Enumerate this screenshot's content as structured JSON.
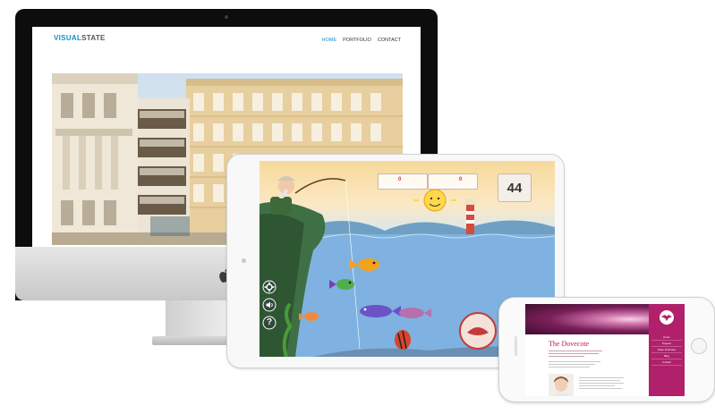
{
  "desktop": {
    "site": {
      "logo_bold": "VISUAL",
      "logo_rest": "STATE"
    },
    "nav": [
      {
        "label": "HOME"
      },
      {
        "label": "PORTFOLIO"
      },
      {
        "label": "CONTACT"
      }
    ],
    "colors": {
      "accent": "#1a8cc8"
    }
  },
  "tablet": {
    "game": {
      "score_left": "0",
      "score_right": "0",
      "timer": "44",
      "icons": [
        "gear-icon",
        "sound-icon",
        "help-icon"
      ],
      "help_glyph": "?",
      "colors": {
        "water": "#7fb2e0",
        "sky": "#fbe3b4"
      }
    }
  },
  "phone": {
    "site": {
      "title": "The Dovecote",
      "nav": [
        {
          "label": "Home"
        },
        {
          "label": "Projects"
        },
        {
          "label": "Video Footnotes"
        },
        {
          "label": "Blog"
        },
        {
          "label": "Contact"
        }
      ],
      "colors": {
        "brand": "#b0206b"
      }
    }
  }
}
